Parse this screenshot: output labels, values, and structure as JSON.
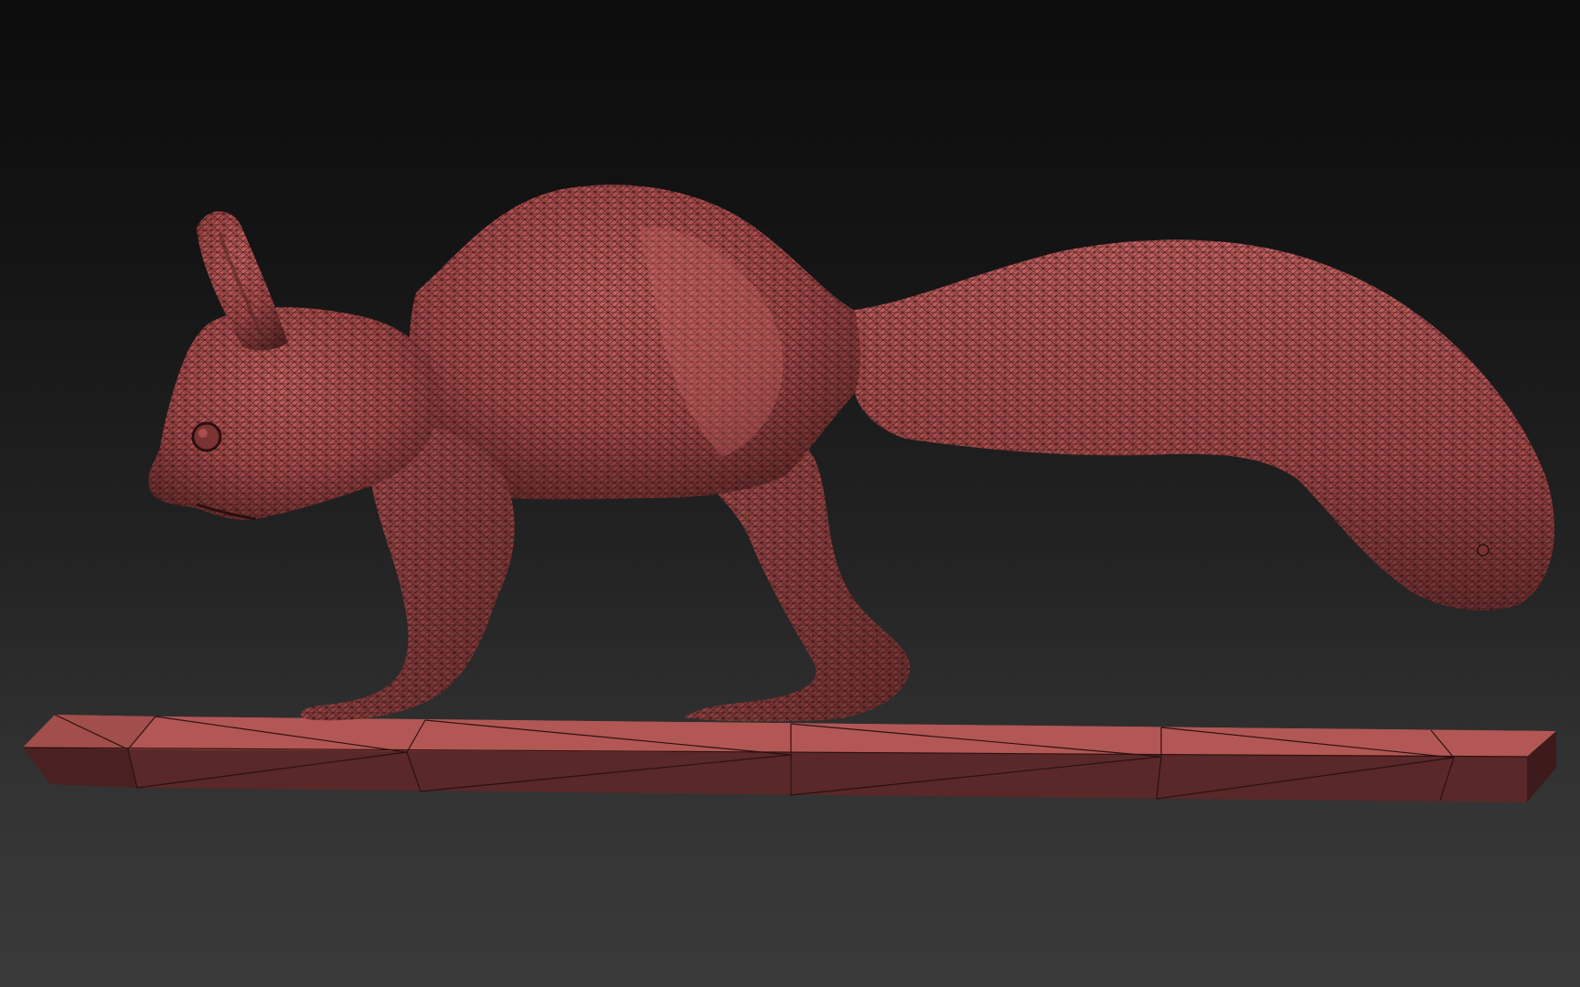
{
  "viewport": {
    "background_top": "#0c0c0c",
    "background_bottom": "#3a3a3a"
  },
  "model": {
    "subject": "squirrel-mesh",
    "material_color": "#b85656",
    "material_shadow": "#5a2626",
    "wire_color": "#2a0f0f",
    "wireframe": true
  },
  "base": {
    "subject": "beam-mesh",
    "top_color": "#b45a58",
    "side_color": "#5a2828",
    "segments": 6
  }
}
